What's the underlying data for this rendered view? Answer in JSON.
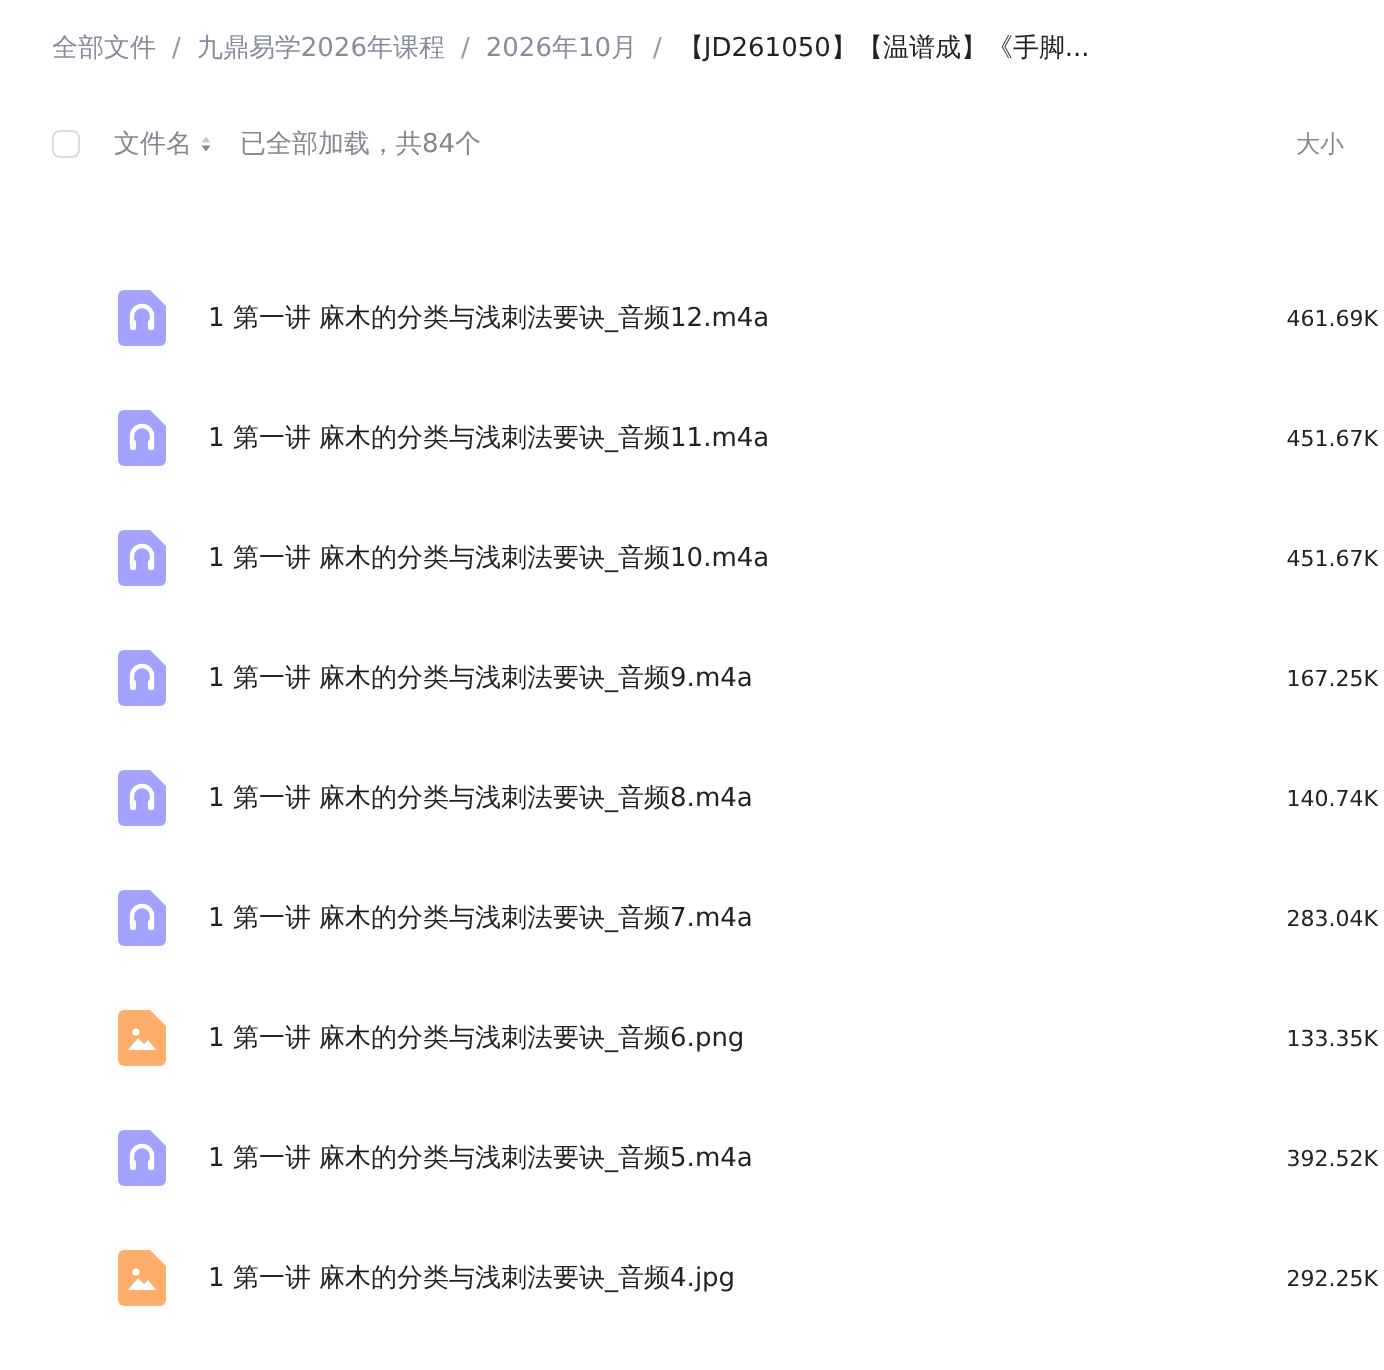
{
  "breadcrumb": [
    {
      "label": "全部文件",
      "current": false
    },
    {
      "label": "九鼎易学2026年课程",
      "current": false
    },
    {
      "label": "2026年10月",
      "current": false
    },
    {
      "label": "【JD261050】【温谱成】《手脚...",
      "current": true
    }
  ],
  "separator": "/",
  "header": {
    "checked": false,
    "name_column": "文件名",
    "status": "已全部加载，共84个",
    "size_column": "大小"
  },
  "files": [
    {
      "kind": "audio",
      "name": "1 第一讲 麻木的分类与浅刺法要诀_音频12.m4a",
      "size": "461.69K"
    },
    {
      "kind": "audio",
      "name": "1 第一讲 麻木的分类与浅刺法要诀_音频11.m4a",
      "size": "451.67K"
    },
    {
      "kind": "audio",
      "name": "1 第一讲 麻木的分类与浅刺法要诀_音频10.m4a",
      "size": "451.67K"
    },
    {
      "kind": "audio",
      "name": "1 第一讲 麻木的分类与浅刺法要诀_音频9.m4a",
      "size": "167.25K"
    },
    {
      "kind": "audio",
      "name": "1 第一讲 麻木的分类与浅刺法要诀_音频8.m4a",
      "size": "140.74K"
    },
    {
      "kind": "audio",
      "name": "1 第一讲 麻木的分类与浅刺法要诀_音频7.m4a",
      "size": "283.04K"
    },
    {
      "kind": "image",
      "name": "1 第一讲 麻木的分类与浅刺法要诀_音频6.png",
      "size": "133.35K"
    },
    {
      "kind": "audio",
      "name": "1 第一讲 麻木的分类与浅刺法要诀_音频5.m4a",
      "size": "392.52K"
    },
    {
      "kind": "image",
      "name": "1 第一讲 麻木的分类与浅刺法要诀_音频4.jpg",
      "size": "292.25K"
    }
  ]
}
